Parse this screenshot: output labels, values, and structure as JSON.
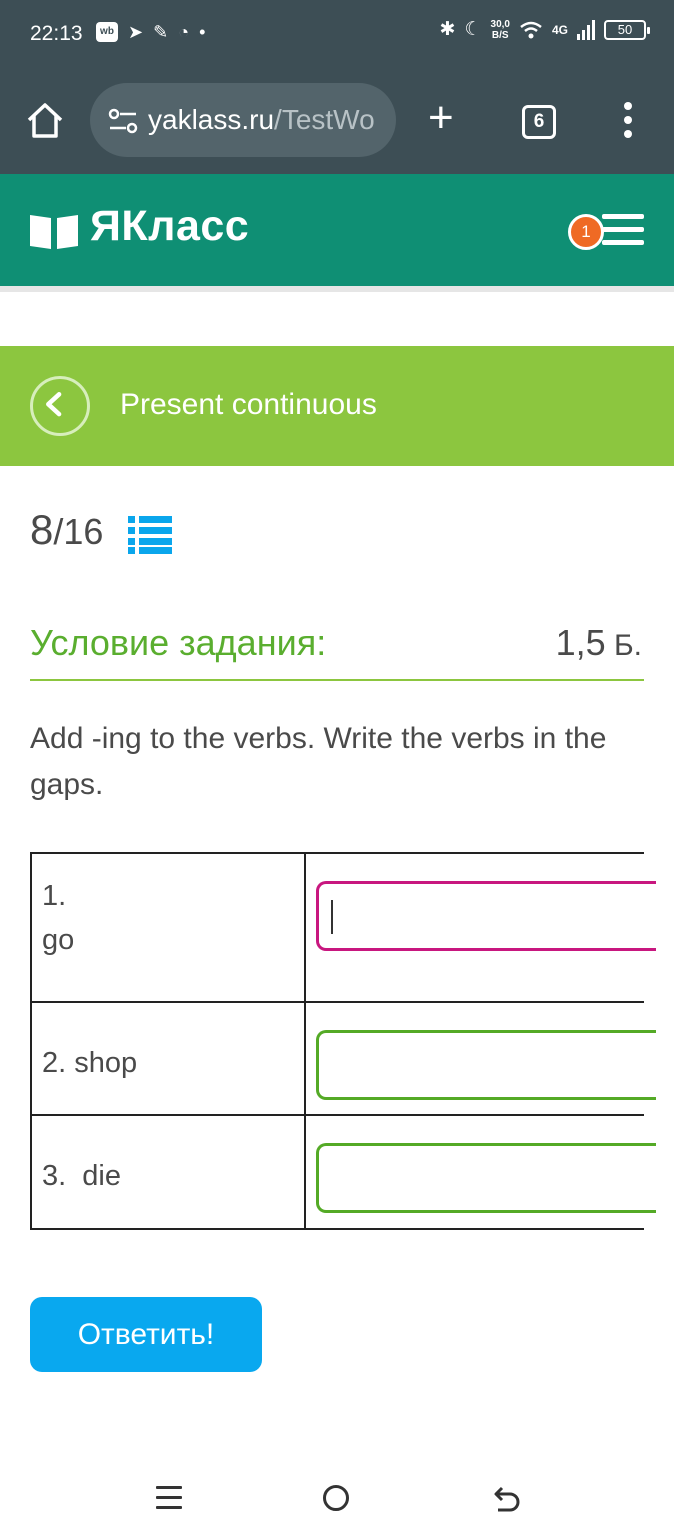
{
  "status_bar": {
    "time": "22:13",
    "speed_value": "30,0",
    "speed_unit": "B/S",
    "network": "4G",
    "battery": "50"
  },
  "browser": {
    "url_host": "yaklass.ru",
    "url_path": "/TestWo",
    "tab_count": "6"
  },
  "site": {
    "logo": "ЯКласс",
    "notification_count": "1"
  },
  "topic": {
    "title": "Present continuous"
  },
  "progress": {
    "current": "8",
    "total": "/16"
  },
  "task": {
    "label": "Условие задания:",
    "points": "1,5",
    "points_unit": " Б.",
    "instruction": "Add -ing to the verbs. Write the verbs in the gaps.",
    "rows": [
      {
        "number": "1.",
        "verb": "go",
        "answer": ""
      },
      {
        "number": "2.",
        "verb": "shop",
        "answer": ""
      },
      {
        "number": "3.",
        "verb": " die",
        "answer": ""
      }
    ]
  },
  "submit_label": "Ответить!",
  "colors": {
    "header": "#0f8f74",
    "banner": "#8cc63f",
    "accent_green": "#5aae2f",
    "active_input": "#c8177f",
    "submit": "#09a8ef",
    "badge": "#ef6a24"
  }
}
